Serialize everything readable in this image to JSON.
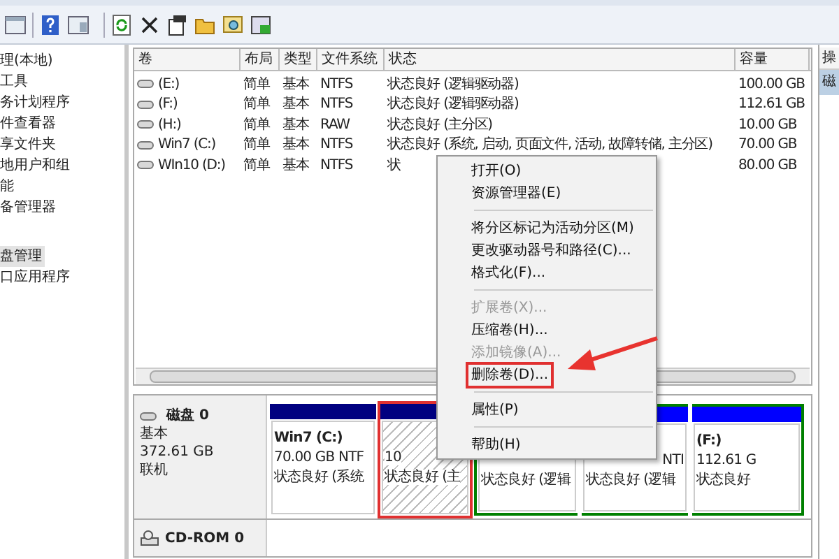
{
  "tree": [
    {
      "label": "理(本地)",
      "selected": false
    },
    {
      "label": "工具",
      "selected": false
    },
    {
      "label": "务计划程序",
      "selected": false
    },
    {
      "label": "件查看器",
      "selected": false
    },
    {
      "label": "享文件夹",
      "selected": false
    },
    {
      "label": "地用户和组",
      "selected": false
    },
    {
      "label": "能",
      "selected": false
    },
    {
      "label": "备管理器",
      "selected": false
    },
    {
      "label": "盘管理",
      "selected": true
    },
    {
      "label": "口应用程序",
      "selected": false
    }
  ],
  "volume_table": {
    "columns": [
      "卷",
      "布局",
      "类型",
      "文件系统",
      "状态",
      "容量"
    ],
    "rows": [
      [
        "(E:)",
        "简单",
        "基本",
        "NTFS",
        "状态良好 (逻辑驱动器)",
        "100.00 GB"
      ],
      [
        "(F:)",
        "简单",
        "基本",
        "NTFS",
        "状态良好 (逻辑驱动器)",
        "112.61 GB"
      ],
      [
        "(H:)",
        "简单",
        "基本",
        "RAW",
        "状态良好 (主分区)",
        "10.00 GB"
      ],
      [
        "Win7 (C:)",
        "简单",
        "基本",
        "NTFS",
        "状态良好 (系统, 启动, 页面文件, 活动, 故障转储, 主分区)",
        "70.00 GB"
      ],
      [
        "WIn10 (D:)",
        "简单",
        "基本",
        "NTFS",
        "状",
        "80.00 GB"
      ]
    ]
  },
  "actions": {
    "header": "操",
    "item": "磁"
  },
  "disk": {
    "name": "磁盘 0",
    "type": "基本",
    "size": "372.61 GB",
    "status": "联机",
    "partitions": [
      {
        "kind": "primary",
        "name": "Win7  (C:)",
        "size": "70.00 GB NTF",
        "status": "状态良好 (系统",
        "highlighted": false
      },
      {
        "kind": "raw",
        "size": "10",
        "status": "状态良好 (主",
        "highlighted": true
      },
      {
        "kind": "logical",
        "status": "状态良好 (逻辑",
        "highlighted": false
      },
      {
        "kind": "logical",
        "size": "NTI",
        "status": "状态良好 (逻辑",
        "highlighted": false
      },
      {
        "kind": "logical",
        "name": "(F:)",
        "size": "112.61 G",
        "status": "状态良好",
        "highlighted": false
      }
    ]
  },
  "cdrom": {
    "name": "CD-ROM 0"
  },
  "context_menu": [
    {
      "kind": "item",
      "label": "打开(O)",
      "disabled": false,
      "highlighted": false
    },
    {
      "kind": "item",
      "label": "资源管理器(E)",
      "disabled": false,
      "highlighted": false
    },
    {
      "kind": "separator"
    },
    {
      "kind": "item",
      "label": "将分区标记为活动分区(M)",
      "disabled": false,
      "highlighted": false
    },
    {
      "kind": "item",
      "label": "更改驱动器号和路径(C)...",
      "disabled": false,
      "highlighted": false
    },
    {
      "kind": "item",
      "label": "格式化(F)...",
      "disabled": false,
      "highlighted": false
    },
    {
      "kind": "separator"
    },
    {
      "kind": "item",
      "label": "扩展卷(X)...",
      "disabled": true,
      "highlighted": false
    },
    {
      "kind": "item",
      "label": "压缩卷(H)...",
      "disabled": false,
      "highlighted": false
    },
    {
      "kind": "item",
      "label": "添加镜像(A)...",
      "disabled": true,
      "highlighted": false
    },
    {
      "kind": "item",
      "label": "删除卷(D)...",
      "disabled": false,
      "highlighted": true
    },
    {
      "kind": "separator"
    },
    {
      "kind": "item",
      "label": "属性(P)",
      "disabled": false,
      "highlighted": false
    },
    {
      "kind": "separator"
    },
    {
      "kind": "item",
      "label": "帮助(H)",
      "disabled": false,
      "highlighted": false
    }
  ]
}
